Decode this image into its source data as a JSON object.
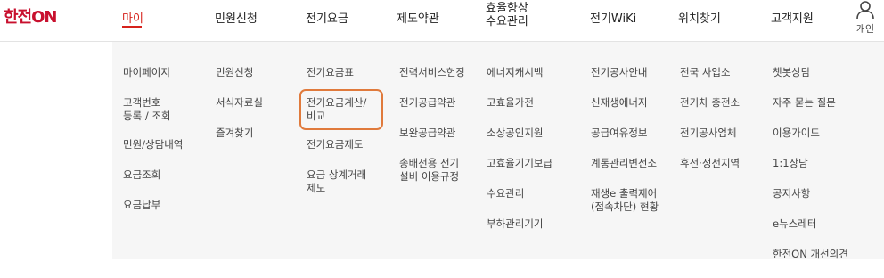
{
  "logo": {
    "text": "한전ON"
  },
  "nav": [
    {
      "label": "마이"
    },
    {
      "label": "민원신청"
    },
    {
      "label": "전기요금"
    },
    {
      "label": "제도약관"
    },
    {
      "label": "효율향상\n수요관리"
    },
    {
      "label": "전기WiKi"
    },
    {
      "label": "위치찾기"
    },
    {
      "label": "고객지원"
    }
  ],
  "user": {
    "icon": "person-icon",
    "label": "개인"
  },
  "accent_color": "#d6221c",
  "highlight_color": "#e07a3c",
  "columns": [
    [
      "마이페이지",
      "고객번호\n등록 / 조회",
      "민원/상담내역",
      "요금조회",
      "요금납부"
    ],
    [
      "민원신청",
      "서식자료실",
      "즐겨찾기"
    ],
    [
      "전기요금표",
      "전기요금계산/\n비교",
      "전기요금제도",
      "요금 상계거래\n제도"
    ],
    [
      "전력서비스헌장",
      "전기공급약관",
      "보완공급약관",
      "송배전용 전기\n설비 이용규정"
    ],
    [
      "에너지캐시백",
      "고효율가전",
      "소상공인지원",
      "고효율기기보급",
      "수요관리",
      "부하관리기기"
    ],
    [
      "전기공사안내",
      "신재생에너지",
      "공급여유정보",
      "계통관리변전소",
      "재생e 출력제어\n(접속차단) 현황"
    ],
    [
      "전국 사업소",
      "전기차 충전소",
      "전기공사업체",
      "휴전·정전지역"
    ],
    [
      "챗봇상담",
      "자주 묻는 질문",
      "이용가이드",
      "1:1상담",
      "공지사항",
      "e뉴스레터",
      "한전ON 개선의견"
    ]
  ]
}
